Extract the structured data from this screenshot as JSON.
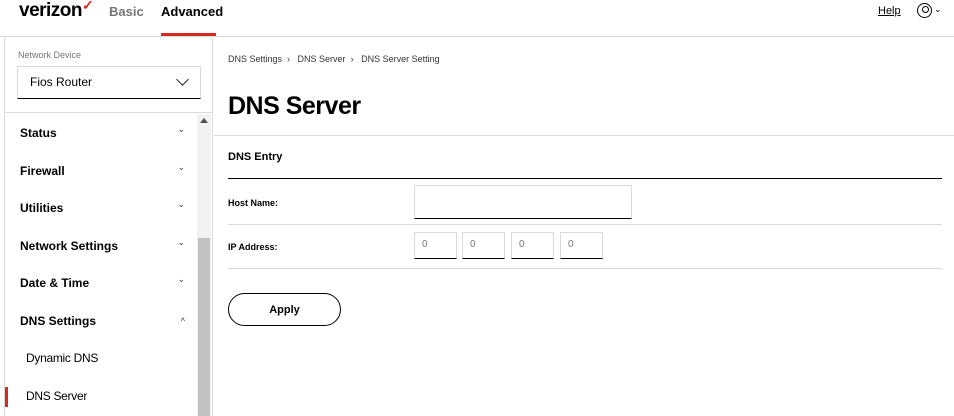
{
  "header": {
    "logo": "verizon",
    "tabs": [
      {
        "label": "Basic"
      },
      {
        "label": "Advanced"
      }
    ],
    "help": "Help"
  },
  "sidebar": {
    "device_label": "Network Device",
    "device_value": "Fios Router",
    "items": [
      {
        "label": "Status"
      },
      {
        "label": "Firewall"
      },
      {
        "label": "Utilities"
      },
      {
        "label": "Network Settings"
      },
      {
        "label": "Date & Time"
      },
      {
        "label": "DNS Settings"
      }
    ],
    "subitems": [
      {
        "label": "Dynamic DNS"
      },
      {
        "label": "DNS Server"
      }
    ]
  },
  "breadcrumb": [
    "DNS Settings",
    "DNS Server",
    "DNS Server Setting"
  ],
  "main": {
    "title": "DNS Server",
    "section": "DNS Entry",
    "host_label": "Host Name:",
    "host_value": "",
    "ip_label": "IP Address:",
    "ip": [
      "0",
      "0",
      "0",
      "0"
    ],
    "apply": "Apply"
  },
  "colors": {
    "accent": "#d52b1e"
  }
}
